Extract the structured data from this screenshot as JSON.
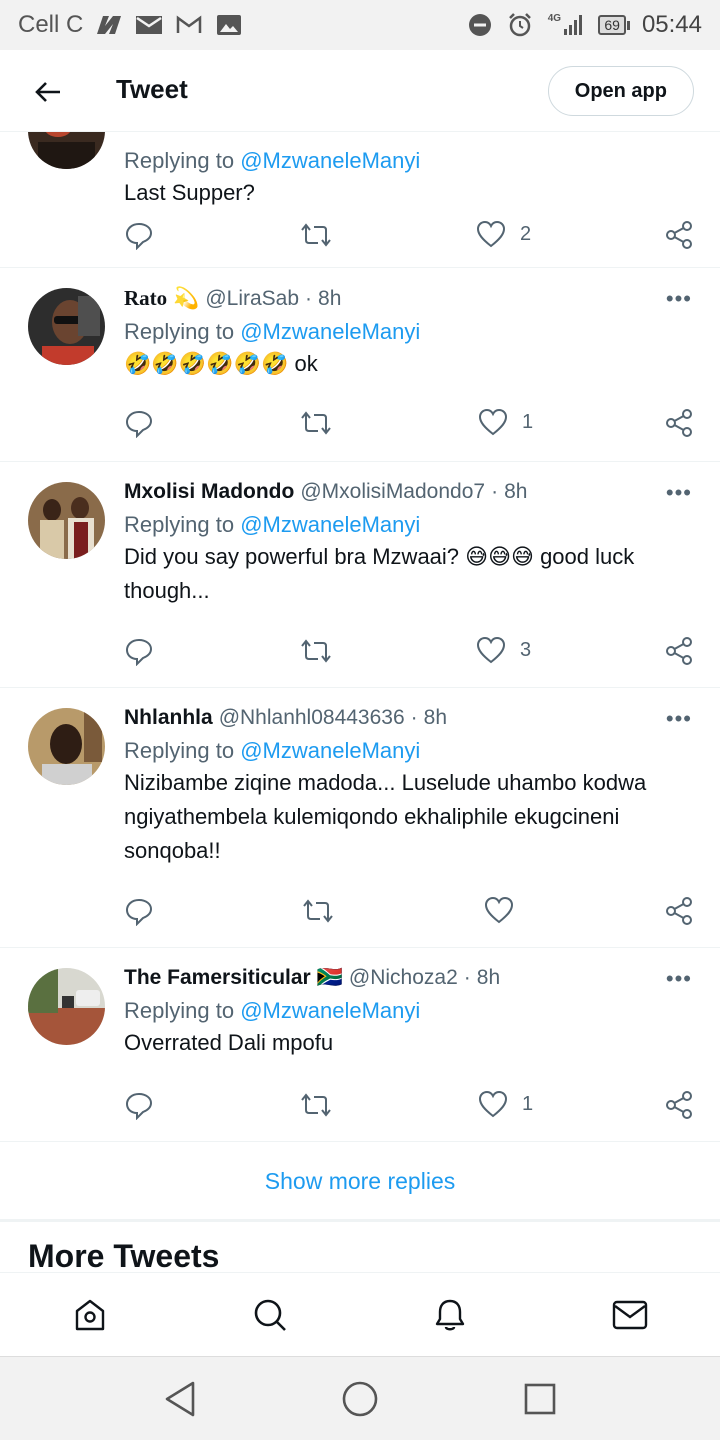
{
  "status_bar": {
    "carrier": "Cell C",
    "network": "4G",
    "battery": "69",
    "time": "05:44"
  },
  "header": {
    "title": "Tweet",
    "open_app": "Open app"
  },
  "replies": [
    {
      "name": "",
      "handle": "",
      "time": "",
      "replying_prefix": "Replying to",
      "replying_to": "@MzwaneleManyi",
      "text": "Last Supper?",
      "likes": "2"
    },
    {
      "name": "Rato",
      "name_emoji": "💫",
      "handle": "@LiraSab",
      "time": "8h",
      "replying_prefix": "Replying to",
      "replying_to": "@MzwaneleManyi",
      "text": "🤣🤣🤣🤣🤣🤣 ok",
      "likes": "1"
    },
    {
      "name": "Mxolisi Madondo",
      "handle": "@MxolisiMadondo7",
      "time": "8h",
      "replying_prefix": "Replying to",
      "replying_to": "@MzwaneleManyi",
      "text": "Did you say powerful bra Mzwaai? 😅😅😅 good luck though...",
      "likes": "3"
    },
    {
      "name": "Nhlanhla",
      "handle": "@Nhlanhl08443636",
      "time": "8h",
      "replying_prefix": "Replying to",
      "replying_to": "@MzwaneleManyi",
      "text": "Nizibambe ziqine madoda... Luselude uhambo kodwa ngiyathembela kulemiqondo ekhaliphile ekugcineni sonqoba!!",
      "likes": ""
    },
    {
      "name": "The Famersiticular",
      "name_emoji": "🇿🇦",
      "handle": "@Nichoza2",
      "time": "8h",
      "replying_prefix": "Replying to",
      "replying_to": "@MzwaneleManyi",
      "text": "Overrated Dali mpofu",
      "likes": "1"
    }
  ],
  "show_more": "Show more replies",
  "more_tweets": "More Tweets",
  "icons": {
    "back": "arrow-left-icon",
    "reply": "reply-icon",
    "retweet": "retweet-icon",
    "like": "heart-icon",
    "share": "share-icon",
    "home": "home-icon",
    "search": "search-icon",
    "notifications": "bell-icon",
    "messages": "mail-icon"
  },
  "colors": {
    "accent": "#1d9bf0",
    "secondary_text": "#536471",
    "primary_text": "#0f1419",
    "divider": "#eff3f4"
  }
}
